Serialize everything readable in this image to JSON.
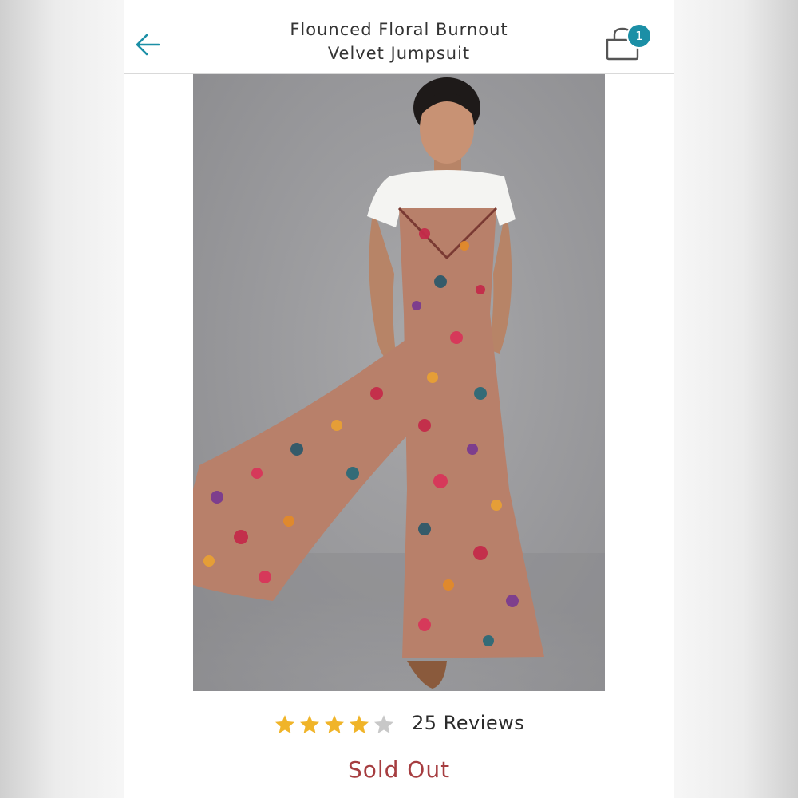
{
  "header": {
    "title_line1": "Flounced Floral Burnout",
    "title_line2": "Velvet Jumpsuit",
    "back_icon": "arrow-left-icon",
    "cart_icon": "shopping-bag-icon",
    "cart_count": "1"
  },
  "product": {
    "image": "woman-wearing-floral-jumpsuit-photo",
    "rating": {
      "value": 4,
      "max": 5,
      "reviews_label": "25 Reviews"
    },
    "status": "Sold Out"
  },
  "colors": {
    "accent": "#1b8fa6",
    "star_filled": "#f0b429",
    "star_empty": "#c8c8c8",
    "sold_out": "#a63d40"
  }
}
